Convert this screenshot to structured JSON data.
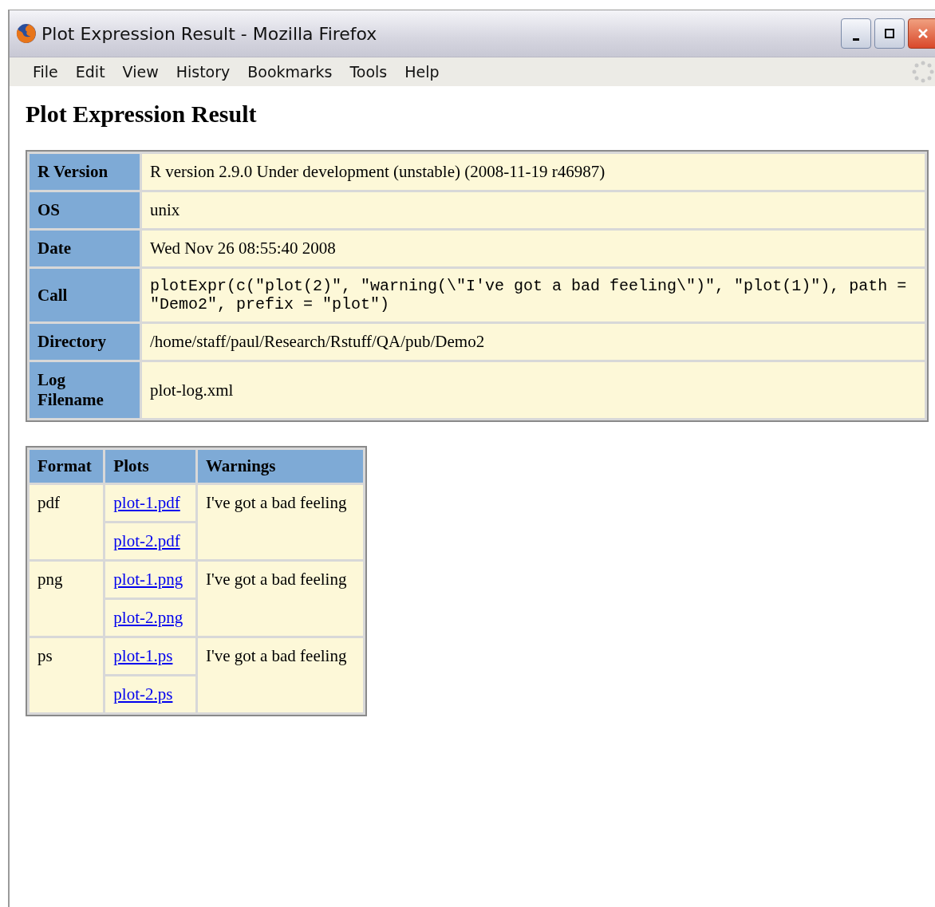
{
  "window": {
    "title": "Plot Expression Result - Mozilla Firefox"
  },
  "menu": [
    {
      "label": "File"
    },
    {
      "label": "Edit"
    },
    {
      "label": "View"
    },
    {
      "label": "History"
    },
    {
      "label": "Bookmarks"
    },
    {
      "label": "Tools"
    },
    {
      "label": "Help"
    }
  ],
  "page": {
    "heading": "Plot Expression Result",
    "info_table": [
      {
        "label": "R Version",
        "value": "R version 2.9.0 Under development (unstable) (2008-11-19 r46987)",
        "kind": "text"
      },
      {
        "label": "OS",
        "value": "unix",
        "kind": "text"
      },
      {
        "label": "Date",
        "value": "Wed Nov 26 08:55:40 2008",
        "kind": "text"
      },
      {
        "label": "Call",
        "value": "plotExpr(c(\"plot(2)\", \"warning(\\\"I've got a bad feeling\\\")\", \"plot(1)\"), path = \"Demo2\", prefix = \"plot\")",
        "kind": "code"
      },
      {
        "label": "Directory",
        "value": "/home/staff/paul/Research/Rstuff/QA/pub/Demo2",
        "kind": "text"
      },
      {
        "label": "Log Filename",
        "value": "plot-log.xml",
        "kind": "text"
      }
    ],
    "results_table": {
      "columns": [
        "Format",
        "Plots",
        "Warnings"
      ],
      "rows": [
        {
          "format": "pdf",
          "plots": [
            "plot-1.pdf",
            "plot-2.pdf"
          ],
          "warnings": "I've got a bad feeling"
        },
        {
          "format": "png",
          "plots": [
            "plot-1.png",
            "plot-2.png"
          ],
          "warnings": "I've got a bad feeling"
        },
        {
          "format": "ps",
          "plots": [
            "plot-1.ps",
            "plot-2.ps"
          ],
          "warnings": "I've got a bad feeling"
        }
      ]
    }
  }
}
